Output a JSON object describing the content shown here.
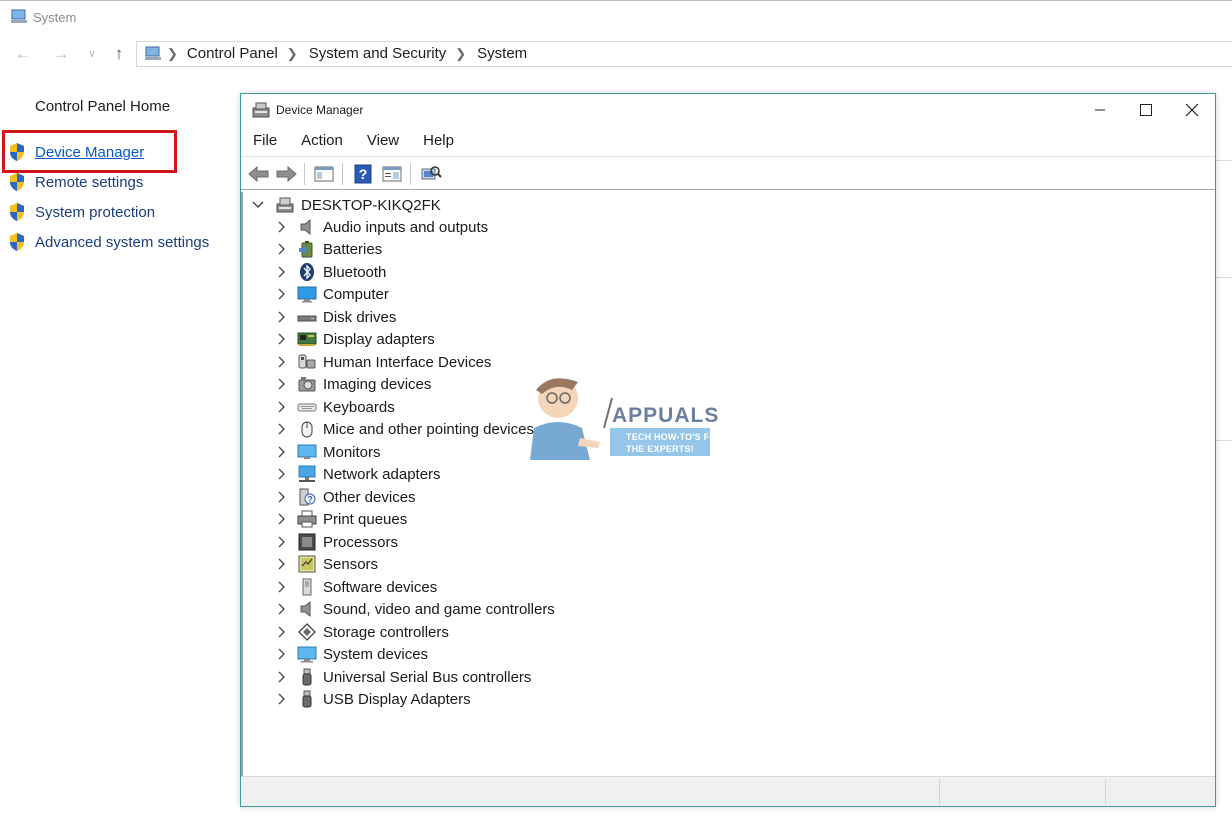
{
  "system_window": {
    "title": "System",
    "address": {
      "crumbs": [
        "Control Panel",
        "System and Security",
        "System"
      ]
    },
    "left_pane": {
      "home_link": "Control Panel Home",
      "tasks": [
        {
          "label": "Device Manager",
          "icon": "uac-shield-icon",
          "highlighted": true
        },
        {
          "label": "Remote settings",
          "icon": "uac-shield-icon"
        },
        {
          "label": "System protection",
          "icon": "uac-shield-icon"
        },
        {
          "label": "Advanced system settings",
          "icon": "uac-shield-icon"
        }
      ]
    },
    "highlight_color": "#d0161c"
  },
  "device_manager": {
    "title": "Device Manager",
    "menu": [
      "File",
      "Action",
      "View",
      "Help"
    ],
    "toolbar": [
      "back-icon",
      "forward-icon",
      "show-hide-console-tree-icon",
      "help-icon",
      "properties-icon",
      "scan-hardware-icon"
    ],
    "root": "DESKTOP-KIKQ2FK",
    "categories": [
      {
        "label": "Audio inputs and outputs",
        "icon": "speaker-icon"
      },
      {
        "label": "Batteries",
        "icon": "battery-icon"
      },
      {
        "label": "Bluetooth",
        "icon": "bluetooth-icon"
      },
      {
        "label": "Computer",
        "icon": "computer-icon"
      },
      {
        "label": "Disk drives",
        "icon": "disk-drive-icon"
      },
      {
        "label": "Display adapters",
        "icon": "display-adapter-icon"
      },
      {
        "label": "Human Interface Devices",
        "icon": "hid-icon"
      },
      {
        "label": "Imaging devices",
        "icon": "camera-icon"
      },
      {
        "label": "Keyboards",
        "icon": "keyboard-icon"
      },
      {
        "label": "Mice and other pointing devices",
        "icon": "mouse-icon"
      },
      {
        "label": "Monitors",
        "icon": "monitor-icon"
      },
      {
        "label": "Network adapters",
        "icon": "network-adapter-icon"
      },
      {
        "label": "Other devices",
        "icon": "unknown-device-icon"
      },
      {
        "label": "Print queues",
        "icon": "printer-icon"
      },
      {
        "label": "Processors",
        "icon": "processor-icon"
      },
      {
        "label": "Sensors",
        "icon": "sensor-icon"
      },
      {
        "label": "Software devices",
        "icon": "software-device-icon"
      },
      {
        "label": "Sound, video and game controllers",
        "icon": "speaker-icon"
      },
      {
        "label": "Storage controllers",
        "icon": "storage-controller-icon"
      },
      {
        "label": "System devices",
        "icon": "system-devices-icon"
      },
      {
        "label": "Universal Serial Bus controllers",
        "icon": "usb-icon"
      },
      {
        "label": "USB Display Adapters",
        "icon": "usb-icon"
      }
    ],
    "accent_color": "#3d9c98"
  },
  "watermark": {
    "brand": "APPUALS",
    "tagline_1": "TECH HOW-TO'S FROM",
    "tagline_2": "THE EXPERTS!"
  }
}
